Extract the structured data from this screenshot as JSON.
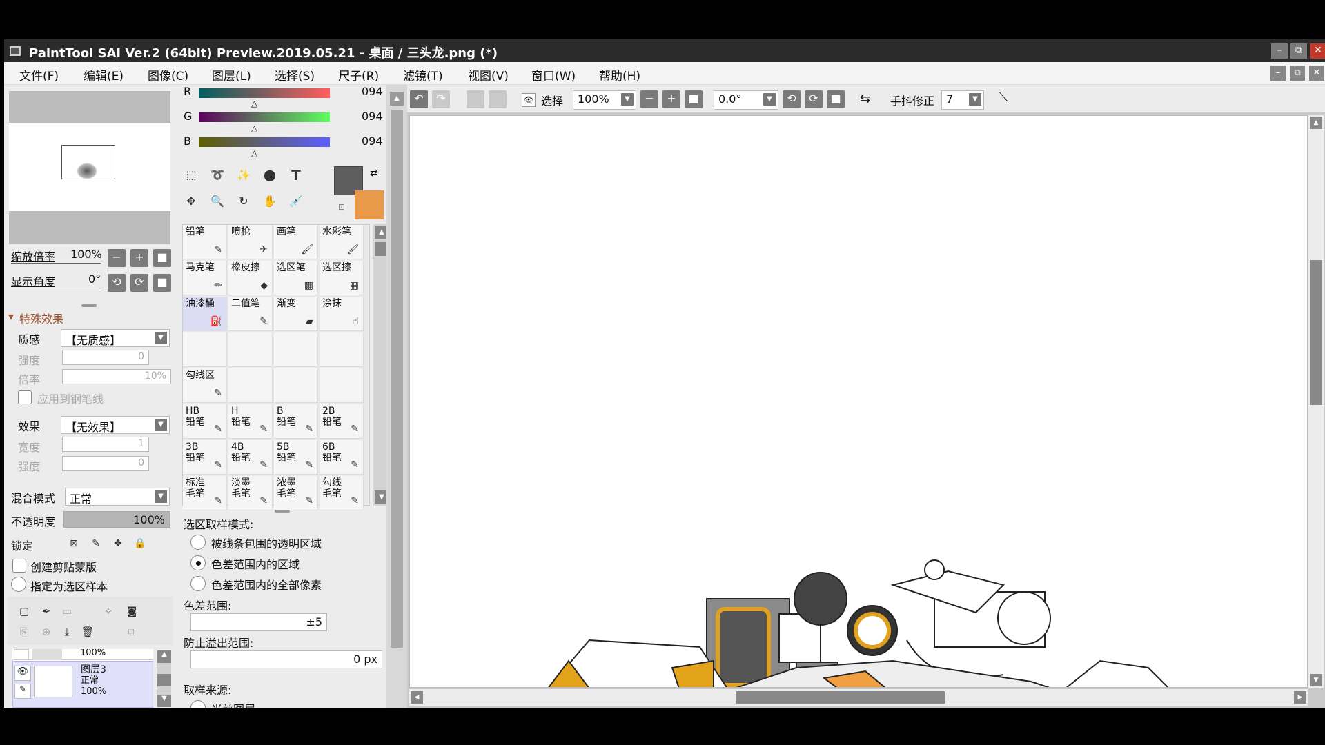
{
  "window": {
    "title": "PaintTool SAI Ver.2 (64bit) Preview.2019.05.21 - 桌面 / 三头龙.png (*)",
    "min": "–",
    "restore": "⧉",
    "close": "✕"
  },
  "menu": [
    "文件(F)",
    "编辑(E)",
    "图像(C)",
    "图层(L)",
    "选择(S)",
    "尺子(R)",
    "滤镜(T)",
    "视图(V)",
    "窗口(W)",
    "帮助(H)"
  ],
  "navigator": {
    "zoom_label": "缩放倍率",
    "zoom_value": "100%",
    "angle_label": "显示角度",
    "angle_value": "0°"
  },
  "effects": {
    "header": "特殊效果",
    "texture_label": "质感",
    "texture_value": "【无质感】",
    "strength_label": "强度",
    "strength_value": "0",
    "rate_label": "倍率",
    "rate_value": "10%",
    "apply_pen_label": "应用到钢笔线",
    "effect_label": "效果",
    "effect_value": "【无效果】",
    "width_label": "宽度",
    "width_value": "1",
    "strength2_label": "强度",
    "strength2_value": "0"
  },
  "layer_props": {
    "blend_label": "混合模式",
    "blend_value": "正常",
    "opacity_label": "不透明度",
    "opacity_value": "100%",
    "opacity_fraction": 1.0,
    "lock_label": "锁定",
    "clip_label": "创建剪贴蒙版",
    "sample_label": "指定为选区样本"
  },
  "layers": [
    {
      "name": "",
      "mode": "",
      "opacity": "100%"
    },
    {
      "name": "图层3",
      "mode": "正常",
      "opacity": "100%"
    }
  ],
  "color": {
    "r_label": "R",
    "r_value": "094",
    "g_label": "G",
    "g_value": "094",
    "b_label": "B",
    "b_value": "094",
    "fg": "#5e5e5e",
    "bg": "#e8994a"
  },
  "brushes": [
    {
      "label": "铅笔",
      "icon": "pencil-icon"
    },
    {
      "label": "喷枪",
      "icon": "airbrush-icon"
    },
    {
      "label": "画笔",
      "icon": "brush-icon"
    },
    {
      "label": "水彩笔",
      "icon": "watercolor-icon"
    },
    {
      "label": "马克笔",
      "icon": "marker-icon"
    },
    {
      "label": "橡皮擦",
      "icon": "eraser-icon"
    },
    {
      "label": "选区笔",
      "icon": "selpen-icon"
    },
    {
      "label": "选区擦",
      "icon": "selerase-icon"
    },
    {
      "label": "油漆桶",
      "icon": "bucket-icon"
    },
    {
      "label": "二值笔",
      "icon": "binary-icon"
    },
    {
      "label": "渐变",
      "icon": "gradient-icon"
    },
    {
      "label": "涂抹",
      "icon": "smudge-icon"
    },
    {
      "label": "",
      "icon": ""
    },
    {
      "label": "",
      "icon": ""
    },
    {
      "label": "",
      "icon": ""
    },
    {
      "label": "",
      "icon": ""
    },
    {
      "label": "勾线区",
      "icon": "pen-icon"
    },
    {
      "label": "",
      "icon": ""
    },
    {
      "label": "",
      "icon": ""
    },
    {
      "label": "",
      "icon": ""
    },
    {
      "label": "HB\n铅笔",
      "icon": "pencil-icon"
    },
    {
      "label": "H\n铅笔",
      "icon": "pencil-icon"
    },
    {
      "label": "B\n铅笔",
      "icon": "pencil-icon"
    },
    {
      "label": "2B\n铅笔",
      "icon": "pencil-icon"
    },
    {
      "label": "3B\n铅笔",
      "icon": "pencil-icon"
    },
    {
      "label": "4B\n铅笔",
      "icon": "pencil-icon"
    },
    {
      "label": "5B\n铅笔",
      "icon": "pencil-icon"
    },
    {
      "label": "6B\n铅笔",
      "icon": "pencil-icon"
    },
    {
      "label": "标准\n毛笔",
      "icon": "pencil-icon"
    },
    {
      "label": "淡墨\n毛笔",
      "icon": "pencil-icon"
    },
    {
      "label": "浓墨\n毛笔",
      "icon": "pencil-icon"
    },
    {
      "label": "勾线\n毛笔",
      "icon": "pencil-icon"
    }
  ],
  "selected_brush": 8,
  "fill_options": {
    "mode_label": "选区取样模式:",
    "opt1": "被线条包围的透明区域",
    "opt2": "色差范围内的区域",
    "opt3": "色差范围内的全部像素",
    "range_label": "色差范围:",
    "range_value": "±5",
    "overflow_label": "防止溢出范围:",
    "overflow_value": "0 px",
    "source_label": "取样来源:",
    "source_opt1": "当前图层"
  },
  "toolbar": {
    "select_label": "选择",
    "zoom_value": "100%",
    "angle_value": "0.0°",
    "stab_label": "手抖修正",
    "stab_value": "7"
  }
}
